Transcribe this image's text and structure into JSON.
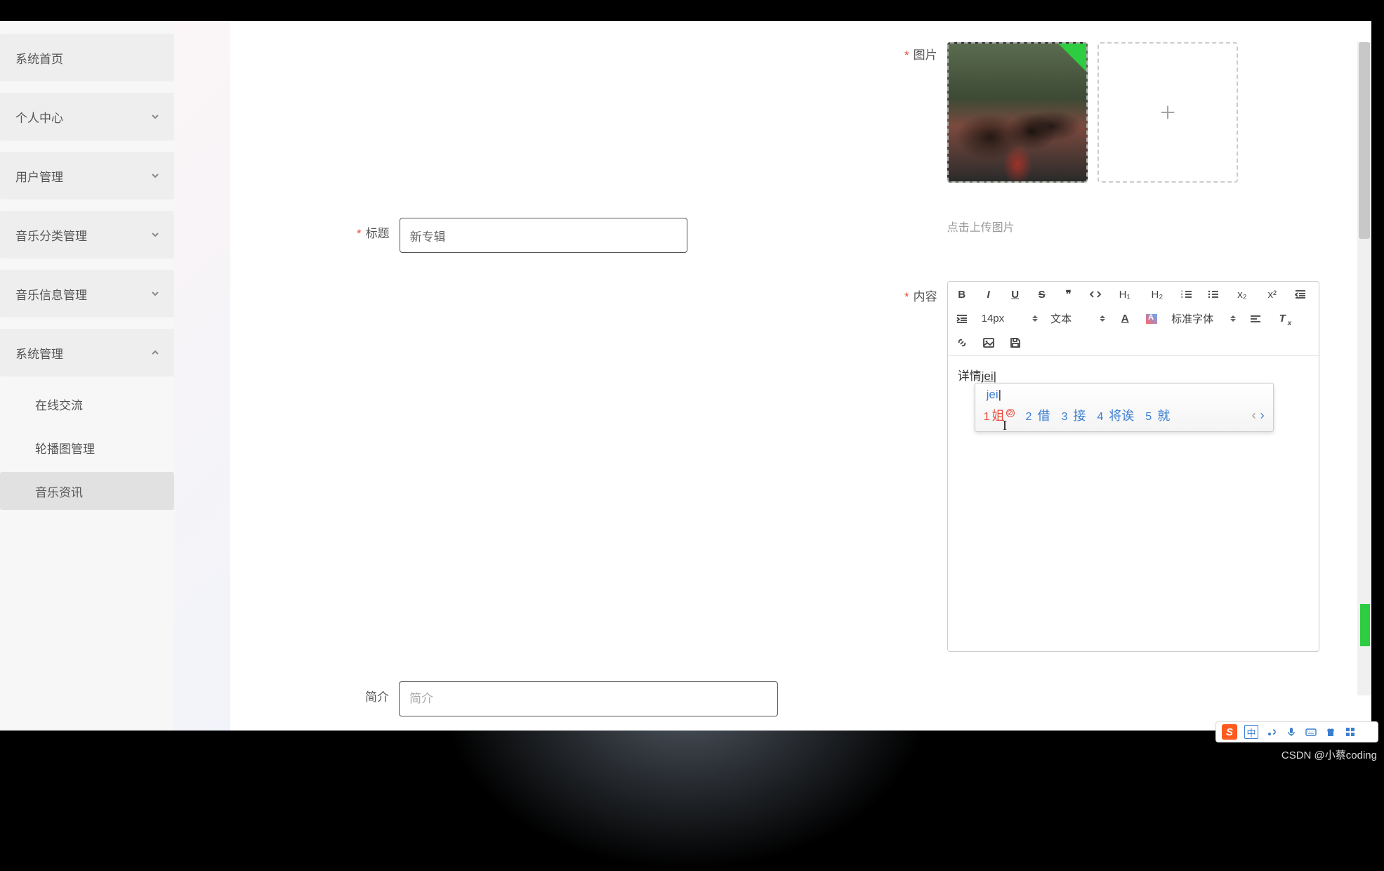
{
  "sidebar": {
    "items": [
      {
        "label": "系统首页",
        "expandable": false
      },
      {
        "label": "个人中心",
        "expandable": true
      },
      {
        "label": "用户管理",
        "expandable": true
      },
      {
        "label": "音乐分类管理",
        "expandable": true
      },
      {
        "label": "音乐信息管理",
        "expandable": true
      },
      {
        "label": "系统管理",
        "expandable": true,
        "expanded": true
      }
    ],
    "subitems": [
      {
        "label": "在线交流"
      },
      {
        "label": "轮播图管理"
      },
      {
        "label": "音乐资讯",
        "active": true
      }
    ]
  },
  "form": {
    "title_label": "标题",
    "title_value": "新专辑",
    "intro_label": "简介",
    "intro_placeholder": "简介",
    "image_label": "图片",
    "upload_hint": "点击上传图片",
    "content_label": "内容",
    "content_text_prefix": "详情",
    "content_text_composing": "jei"
  },
  "editor_toolbar": {
    "font_size": "14px",
    "style_label": "文本",
    "font_family": "标准字体"
  },
  "ime": {
    "input": "jei",
    "candidates": [
      {
        "n": "1",
        "w": "姐"
      },
      {
        "n": "2",
        "w": "借"
      },
      {
        "n": "3",
        "w": "接"
      },
      {
        "n": "4",
        "w": "将诶"
      },
      {
        "n": "5",
        "w": "就"
      }
    ]
  },
  "ime_bar": {
    "logo": "S",
    "mode": "中"
  },
  "watermark": "CSDN @小蔡coding"
}
